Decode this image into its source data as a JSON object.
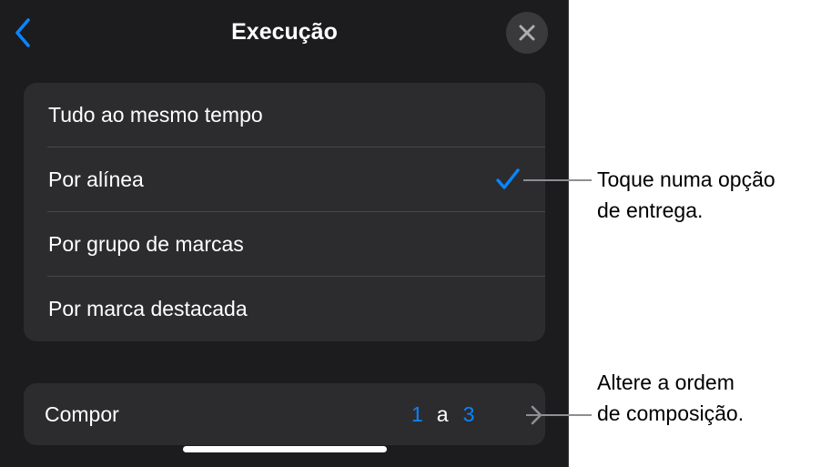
{
  "header": {
    "title": "Execução",
    "back_icon": "chevron-left-icon",
    "close_icon": "close-icon"
  },
  "delivery_options": [
    {
      "label": "Tudo ao mesmo tempo",
      "selected": false
    },
    {
      "label": "Por alínea",
      "selected": true
    },
    {
      "label": "Por grupo de marcas",
      "selected": false
    },
    {
      "label": "Por marca destacada",
      "selected": false
    }
  ],
  "build": {
    "label": "Compor",
    "from": "1",
    "separator": "a",
    "to": "3"
  },
  "callouts": {
    "delivery_line1": "Toque numa opção",
    "delivery_line2": "de entrega.",
    "order_line1": "Altere a ordem",
    "order_line2": "de composição."
  },
  "colors": {
    "accent": "#0a84ff",
    "panel_background": "#1c1c1e",
    "group_background": "#2c2c2e"
  }
}
